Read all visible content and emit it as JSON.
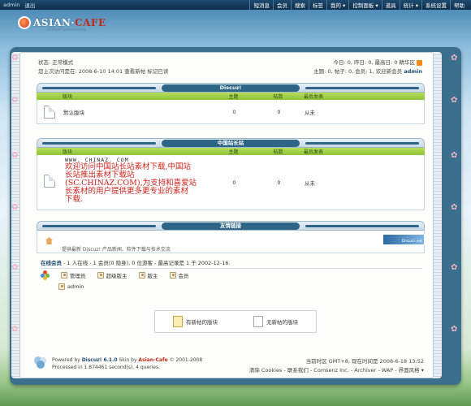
{
  "topbar": {
    "user": "admin",
    "logout": "退出",
    "nav": [
      "短消息",
      "会员",
      "搜索",
      "标签",
      "我的 ▾",
      "控制面板 ▾",
      "道具",
      "统计 ▾",
      "系统设置",
      "帮助"
    ]
  },
  "logo": {
    "brand_a": "ASIAN",
    "brand_sep": "·",
    "brand_b": "CAFE",
    "tagline": "Discuz! community"
  },
  "status": {
    "line1": "状态: 正常模式",
    "line2": "您上次访问是在: 2008-6-10 14:01  查看新帖  标记已读",
    "right_line1": "今日: 0, 昨日: 0, 最高日: 0  精华区",
    "right_line2_prefix": "主题: 0, 帖子: 0, 会员: 1, 欢迎新会员",
    "right_line2_user": "admin"
  },
  "columns": {
    "forum": "版块",
    "topics": "主题",
    "posts": "帖数",
    "last": "最后发表"
  },
  "discuz_section": {
    "title": "Discuz!",
    "forum_name": "默认版块",
    "topics": "0",
    "posts": "0",
    "last": "从未"
  },
  "chinaz_section": {
    "title": "中国站长站",
    "promo_url": "WWW. CHINAZ. COM",
    "promo_lines": [
      "欢迎访问中国站长站素材下载,中国站",
      "长站推出素材下载站",
      "(SC.CHINAZ.COM),为支持和喜爱站",
      "长素材的用户提供更多更专业的素材",
      "下载."
    ],
    "topics": "0",
    "posts": "0",
    "last": "从未"
  },
  "links_section": {
    "title": "友情链接",
    "text": "提供最新 Discuz! 产品新闻、软件下载与技术交流",
    "banner_text": "Discuz!.net"
  },
  "online": {
    "summary_label": "在线会员",
    "summary_rest": " - 1 人在线 - 1 会员(0 隐身), 0 位游客 - 最高记录是 1 于 2002-12-16.",
    "legend": [
      "管理员",
      "超级版主",
      "版主",
      "会员"
    ],
    "user": "admin"
  },
  "legend_box": {
    "new": "有新帖的版块",
    "none": "无新帖的版块"
  },
  "footer": {
    "powered": "Powered by",
    "product": "Discuz! 6.1.0",
    "skin_by": "Skin by",
    "skin": "Asian-Cafe",
    "copy": "© 2001-2008",
    "processed": "Processed in 1.874461 second(s), 4 queries.",
    "time": "当前时区  GMT+8, 现在时间是  2008-6-18 13:52",
    "links": "清除  Cookies - 联系我们 - Comsenz Inc. - Archiver - WAP - 界面风格 ▾"
  },
  "colors": {
    "accent": "#2e6486",
    "green": "#8cc33a",
    "promo_red": "#d0201a"
  }
}
